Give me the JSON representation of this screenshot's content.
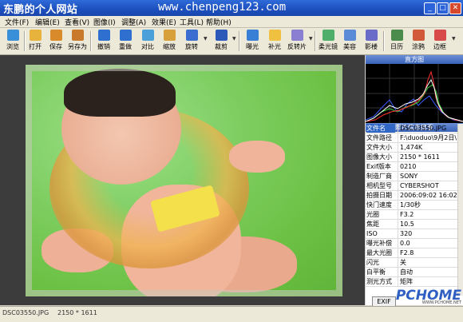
{
  "window": {
    "title": "东鹏的个人网站",
    "url_text": "www.chenpeng123.com",
    "buttons": [
      "_",
      "□",
      "✕"
    ]
  },
  "menu": [
    "文件(F)",
    "编辑(E)",
    "查看(V)",
    "图像(I)",
    "调整(A)",
    "效果(E)",
    "工具(L)",
    "帮助(H)"
  ],
  "toolbar": [
    {
      "label": "浏览",
      "icon": "browse-icon",
      "color": "#3a8fd9"
    },
    {
      "label": "打开",
      "icon": "open-folder-icon",
      "color": "#e8b33c"
    },
    {
      "label": "保存",
      "icon": "save-icon",
      "color": "#d98b2c"
    },
    {
      "label": "另存为",
      "icon": "save-as-icon",
      "color": "#c97a2a"
    },
    {
      "label": "撤销",
      "icon": "undo-icon",
      "color": "#2f6fd0"
    },
    {
      "label": "重做",
      "icon": "redo-icon",
      "color": "#2f6fd0"
    },
    {
      "label": "对比",
      "icon": "compare-icon",
      "color": "#4aa0d8"
    },
    {
      "label": "缩放",
      "icon": "zoom-icon",
      "color": "#d8a03a"
    },
    {
      "label": "旋转",
      "icon": "rotate-icon",
      "color": "#3b6ccf"
    },
    {
      "label": "裁剪",
      "icon": "crop-icon",
      "color": "#2d5ab8"
    },
    {
      "label": "曝光",
      "icon": "exposure-icon",
      "color": "#3a7fd6"
    },
    {
      "label": "补光",
      "icon": "fill-light-icon",
      "color": "#f0c040"
    },
    {
      "label": "反转片",
      "icon": "reversal-film-icon",
      "color": "#8a7fd0"
    },
    {
      "label": "柔光镜",
      "icon": "soft-filter-icon",
      "color": "#4fae6a"
    },
    {
      "label": "美容",
      "icon": "beauty-icon",
      "color": "#5b8bd6"
    },
    {
      "label": "影楼",
      "icon": "studio-icon",
      "color": "#6a6ac8"
    },
    {
      "label": "日历",
      "icon": "calendar-icon",
      "color": "#4b8b4b"
    },
    {
      "label": "涂鸦",
      "icon": "doodle-icon",
      "color": "#d05a3a"
    },
    {
      "label": "边框",
      "icon": "border-icon",
      "color": "#d84a4a"
    }
  ],
  "histogram": {
    "title": "直方图"
  },
  "exif": {
    "title": "照片信息摘要",
    "tab": "EXIF",
    "rows": [
      {
        "k": "文件名",
        "v": "DSC03550.JPG"
      },
      {
        "k": "文件路径",
        "v": "F:\\duoduo\\9月2日\\"
      },
      {
        "k": "文件大小",
        "v": "1,474K"
      },
      {
        "k": "图像大小",
        "v": "2150 * 1611"
      },
      {
        "k": "Exif版本",
        "v": "0210"
      },
      {
        "k": "制造厂商",
        "v": "SONY"
      },
      {
        "k": "相机型号",
        "v": "CYBERSHOT"
      },
      {
        "k": "拍摄日期",
        "v": "2006:09:02 16:02:45"
      },
      {
        "k": "快门速度",
        "v": "1/30秒"
      },
      {
        "k": "光圈",
        "v": "F3.2"
      },
      {
        "k": "焦距",
        "v": "10.5"
      },
      {
        "k": "ISO",
        "v": "320"
      },
      {
        "k": "曝光补偿",
        "v": "0.0"
      },
      {
        "k": "最大光圈",
        "v": "F2.8"
      },
      {
        "k": "闪光",
        "v": "关"
      },
      {
        "k": "白平衡",
        "v": "自动"
      },
      {
        "k": "测光方式",
        "v": "矩阵"
      }
    ]
  },
  "status": {
    "filename": "DSC03550.JPG",
    "dimensions": "2150 * 1611"
  },
  "watermark": {
    "logo": "PCHOME",
    "site": "WWW.PCHOME.NET"
  }
}
